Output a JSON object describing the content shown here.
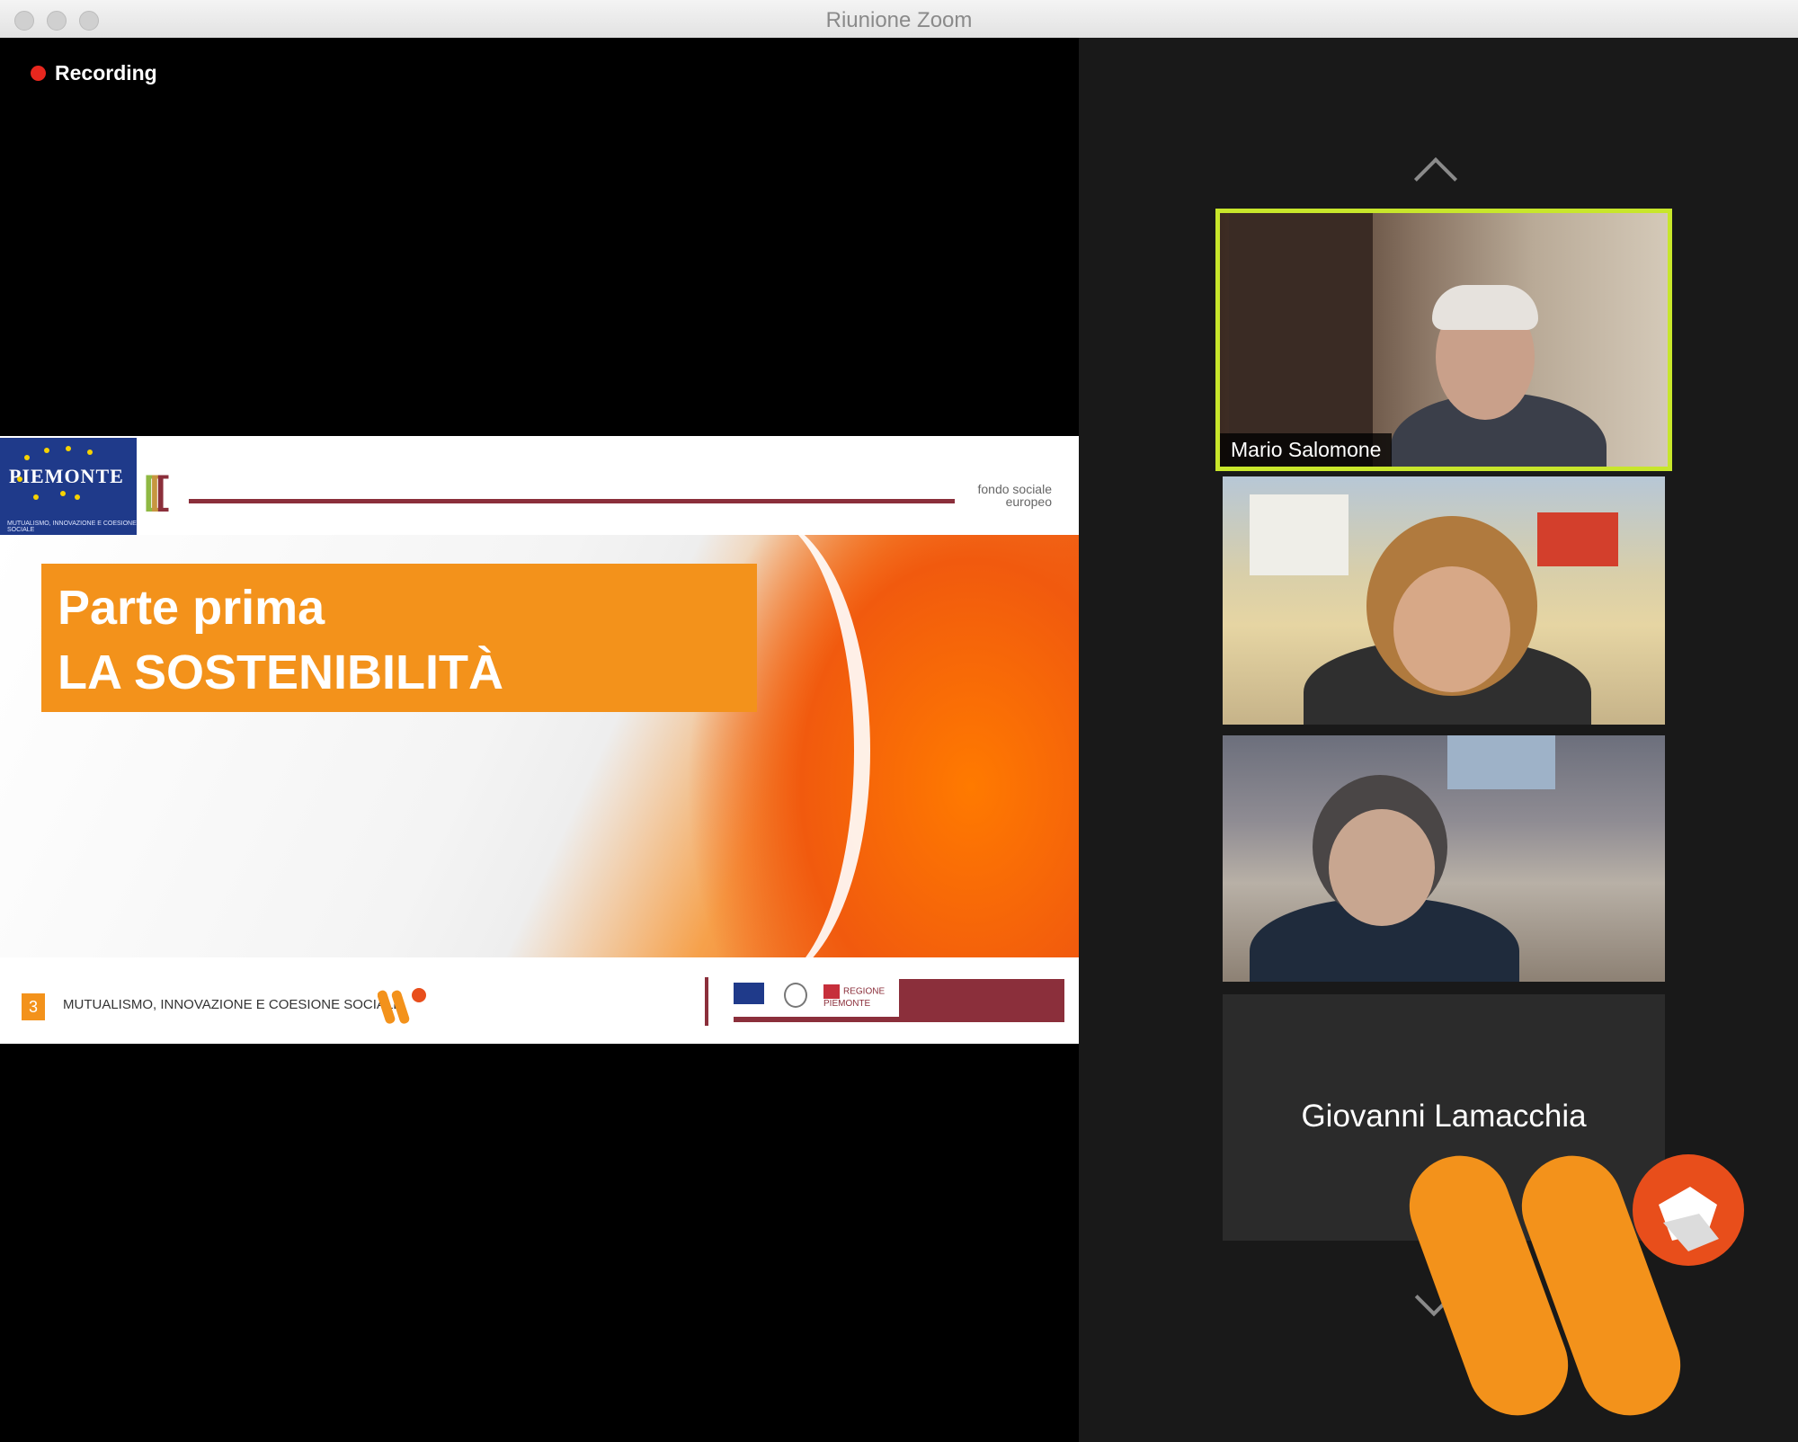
{
  "window": {
    "title": "Riunione Zoom"
  },
  "recording": {
    "label": "Recording"
  },
  "slide": {
    "header_logo_text": "PIEMONTE",
    "header_logo_sub": "MUTUALISMO, INNOVAZIONE E COESIONE SOCIALE",
    "fondo_text": "fondo sociale europeo",
    "title_line1": "Parte prima",
    "title_line2": "LA SOSTENIBILITÀ",
    "page_number": "3",
    "footer_text": "MUTUALISMO, INNOVAZIONE E COESIONE SOCIALE",
    "region_label": "REGIONE PIEMONTE"
  },
  "participants": [
    {
      "name": "Mario Salomone",
      "video": true,
      "active_speaker": true
    },
    {
      "name": "",
      "video": true,
      "active_speaker": false
    },
    {
      "name": "",
      "video": true,
      "active_speaker": false
    },
    {
      "name": "Giovanni Lamacchia",
      "video": false,
      "active_speaker": false
    }
  ],
  "colors": {
    "active_speaker_border": "#c8e62b",
    "recording_dot": "#e8271e",
    "brand_orange": "#f3921b",
    "brand_red": "#e84e1b"
  }
}
